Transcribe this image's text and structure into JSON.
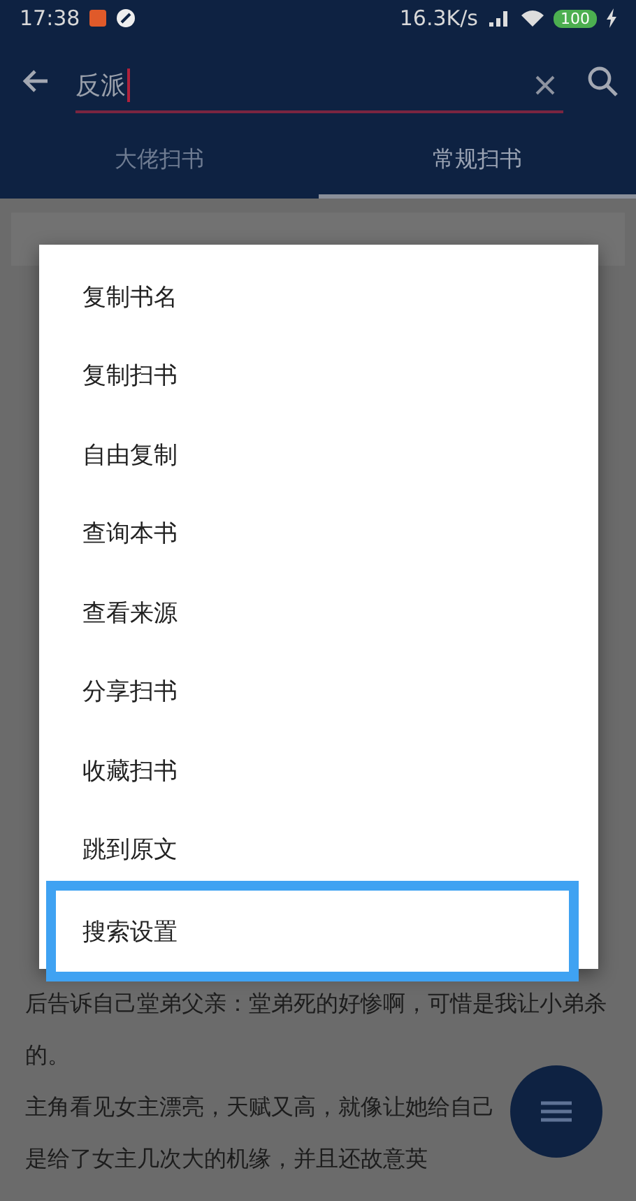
{
  "status_bar": {
    "time": "17:38",
    "speed": "16.3K/s",
    "battery": "100"
  },
  "search": {
    "value": "反派"
  },
  "tabs": [
    {
      "label": "大佬扫书",
      "selected": false
    },
    {
      "label": "常规扫书",
      "selected": true
    }
  ],
  "lines": [
    {
      "kind": "full",
      "text": "后告诉自己堂弟父亲：堂弟死的好惨啊，可惜是我让小弟杀"
    },
    {
      "kind": "full",
      "text": "的。"
    },
    {
      "kind": "full",
      "text": "主角看见女主漂亮，天赋又高，就像让她给自己"
    },
    {
      "kind": "full",
      "text": "是给了女主几次大的机缘，并且还故意英"
    }
  ],
  "menu": [
    {
      "label": "复制书名",
      "highlighted": false
    },
    {
      "label": "复制扫书",
      "highlighted": false
    },
    {
      "label": "自由复制",
      "highlighted": false
    },
    {
      "label": "查询本书",
      "highlighted": false
    },
    {
      "label": "查看来源",
      "highlighted": false
    },
    {
      "label": "分享扫书",
      "highlighted": false
    },
    {
      "label": "收藏扫书",
      "highlighted": false
    },
    {
      "label": "跳到原文",
      "highlighted": false
    },
    {
      "label": "搜索设置",
      "highlighted": true
    }
  ]
}
